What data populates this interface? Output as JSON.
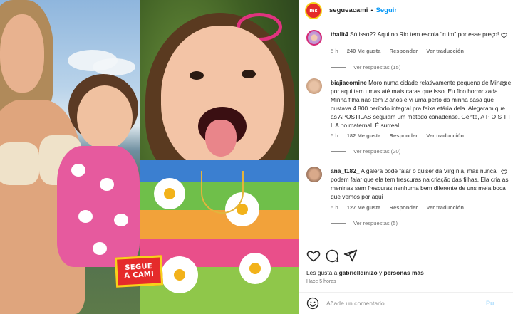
{
  "post": {
    "stamp_line1": "SEGUE",
    "stamp_line2": "A CAMI"
  },
  "header": {
    "avatar_text": "ms",
    "username": "segueacami",
    "separator": "•",
    "follow_label": "Seguir"
  },
  "comments": [
    {
      "username": "thalit4",
      "text": "Só isso?? Aqui no Rio tem escola \"ruim\" por esse preço!",
      "time": "5 h",
      "likes": "240 Me gusta",
      "reply": "Responder",
      "translate": "Ver traducción",
      "replies": "Ver respuestas (15)"
    },
    {
      "username": "biajiacomine",
      "text": "Moro numa cidade relativamente pequena de Minas e por aqui tem umas até mais caras que isso. Eu fico horrorizada. Minha filha não tem 2 anos e vi uma perto da minha casa que custava 4.800 período integral pra faixa etária dela. Alegaram que as APOSTILAS seguiam um método canadense. Gente, A P O S T I L A no maternal. É surreal.",
      "time": "5 h",
      "likes": "182 Me gusta",
      "reply": "Responder",
      "translate": "Ver traducción",
      "replies": "Ver respuestas (20)"
    },
    {
      "username": "ana_t182_",
      "text": "A galera pode falar o quiser da Virgínia, mas nunca podem falar que ela tem frescuras na criação das filhas. Ela cria as meninas sem frescuras nenhuma bem diferente de uns meia boca que vemos por aqui",
      "time": "5 h",
      "likes": "127 Me gusta",
      "reply": "Responder",
      "translate": "Ver traducción",
      "replies": "Ver respuestas (5)"
    }
  ],
  "actions": {
    "like_icon": "heart-icon",
    "comment_icon": "comment-icon",
    "share_icon": "send-icon"
  },
  "likes_line": {
    "prefix": "Les gusta a",
    "user": "gabrielldinizo",
    "conjunction": "y",
    "others": "personas más"
  },
  "timestamp": "Hace 5 horas",
  "add_comment": {
    "placeholder": "Añade un comentario...",
    "publish_label": "Pu"
  },
  "colors": {
    "accent": "#0095f6",
    "stamp_red": "#e52b2b",
    "stamp_yellow": "#f7d21a"
  }
}
